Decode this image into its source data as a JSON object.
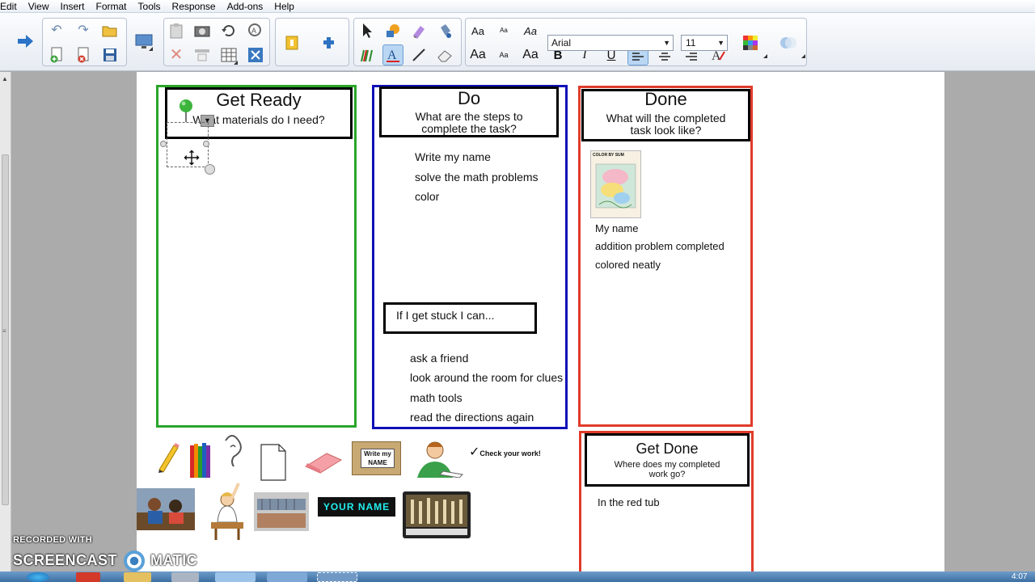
{
  "menu": [
    "Edit",
    "View",
    "Insert",
    "Format",
    "Tools",
    "Response",
    "Add-ons",
    "Help"
  ],
  "toolbar": {
    "font_name": "Arial",
    "font_size": "11",
    "text_style_labels": [
      "Aa",
      "Aa",
      "Aa",
      "Aa",
      "Aa",
      "Aa"
    ],
    "bold_label": "B",
    "italic_label": "I",
    "underline_label": "U"
  },
  "columns": {
    "get_ready": {
      "title": "Get Ready",
      "subtitle": "What materials do I need?",
      "color": "#2aa52a"
    },
    "do": {
      "title": "Do",
      "subtitle": "What are the steps to complete the task?",
      "steps": [
        "Write my name",
        "solve the math problems",
        "color"
      ],
      "stuck_title": "If I get stuck I can...",
      "stuck_items": [
        "ask a friend",
        "look around the room for clues",
        "math tools",
        "read the directions again"
      ],
      "color": "#1010b8"
    },
    "done": {
      "title": "Done",
      "subtitle": "What will the completed task look like?",
      "items": [
        "My name",
        "addition problem completed",
        "colored neatly"
      ],
      "worksheet_label": "COLOR BY SUM",
      "color": "#e03b2a"
    },
    "get_done": {
      "title": "Get Done",
      "subtitle": "Where does my completed work go?",
      "answer": "In the red tub"
    }
  },
  "clipart": {
    "write_my_name_card": "Write my NAME",
    "check_work": "Check your work!",
    "name_banner": "YOUR NAME"
  },
  "watermark": {
    "line1": "RECORDED WITH",
    "line2": "SCREENCAST",
    "line3": "MATIC"
  },
  "clock": "4:07"
}
